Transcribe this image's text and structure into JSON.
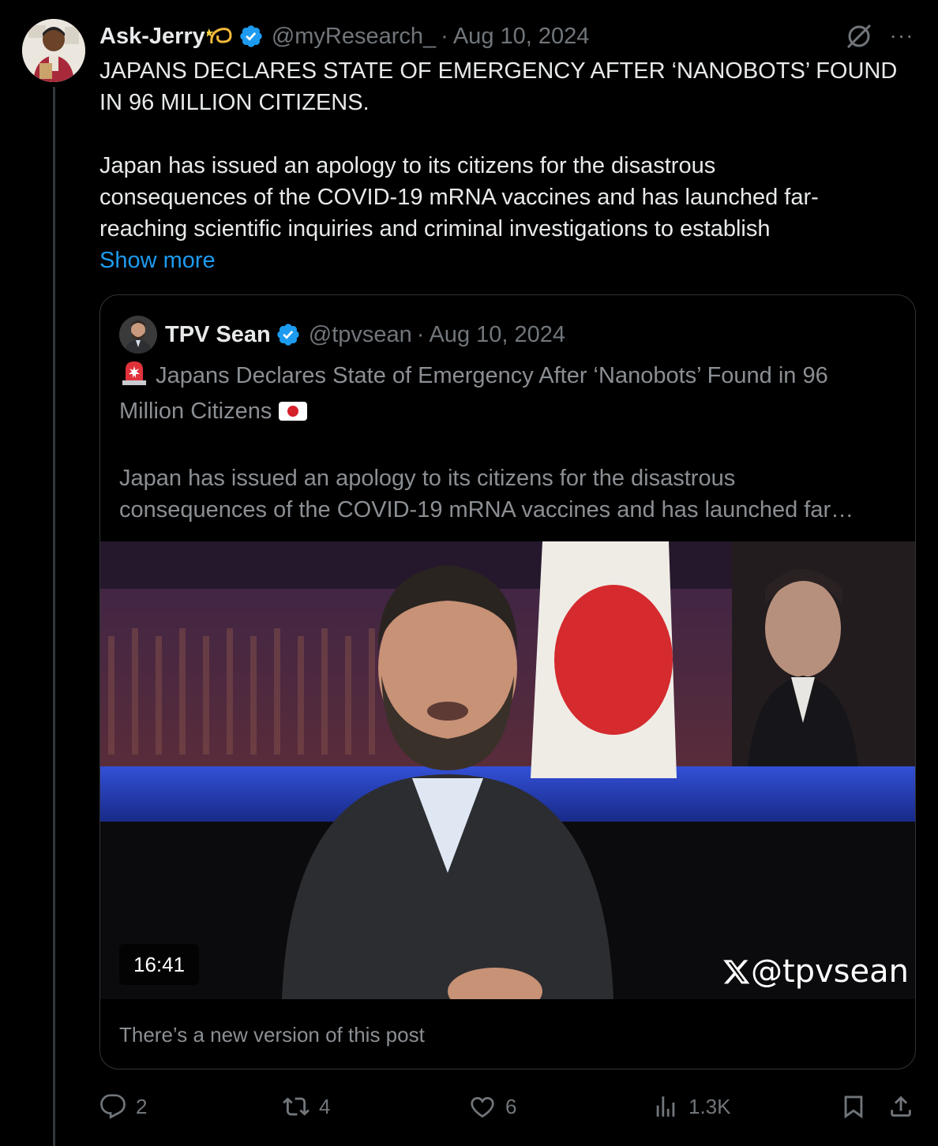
{
  "post": {
    "author_name": "Ask-Jerry",
    "handle": "@myResearch_",
    "separator": "·",
    "date": "Aug 10, 2024",
    "text_line1": "JAPANS DECLARES STATE OF EMERGENCY AFTER ‘NANOBOTS’ FOUND",
    "text_line2": "IN 96 MILLION CITIZENS.",
    "body_line1": "Japan has issued an apology to its citizens for the disastrous",
    "body_line2": "consequences of the COVID-19 mRNA vaccines and has launched far-",
    "body_line3": "reaching scientific inquiries and criminal investigations to establish",
    "show_more": "Show more"
  },
  "quote": {
    "author_name": "TPV Sean",
    "handle": "@tpvsean",
    "separator": "·",
    "date": "Aug 10, 2024",
    "title_line1": "Japans Declares State of Emergency After ‘Nanobots’ Found in 96",
    "title_line2": "Million Citizens",
    "body_line1": "Japan has issued an apology to its citizens for the disastrous",
    "body_line2": "consequences of the COVID-19 mRNA vaccines and has launched far…",
    "video_duration": "16:41",
    "watermark": "@tpvsean",
    "new_version_notice": "There’s a new version of this post"
  },
  "actions": {
    "replies": "2",
    "reposts": "4",
    "likes": "6",
    "views": "1.3K"
  },
  "colors": {
    "background": "#000000",
    "text": "#e7e9ea",
    "muted": "#71767b",
    "link": "#1d9bf0",
    "verified": "#1d9bf0",
    "border": "#2f3336"
  },
  "icons": [
    "grok-icon",
    "more-icon",
    "verified-badge-icon",
    "siren-emoji",
    "japan-flag-emoji",
    "reply-icon",
    "repost-icon",
    "like-icon",
    "views-icon",
    "bookmark-icon",
    "share-icon",
    "x-logo-icon"
  ]
}
